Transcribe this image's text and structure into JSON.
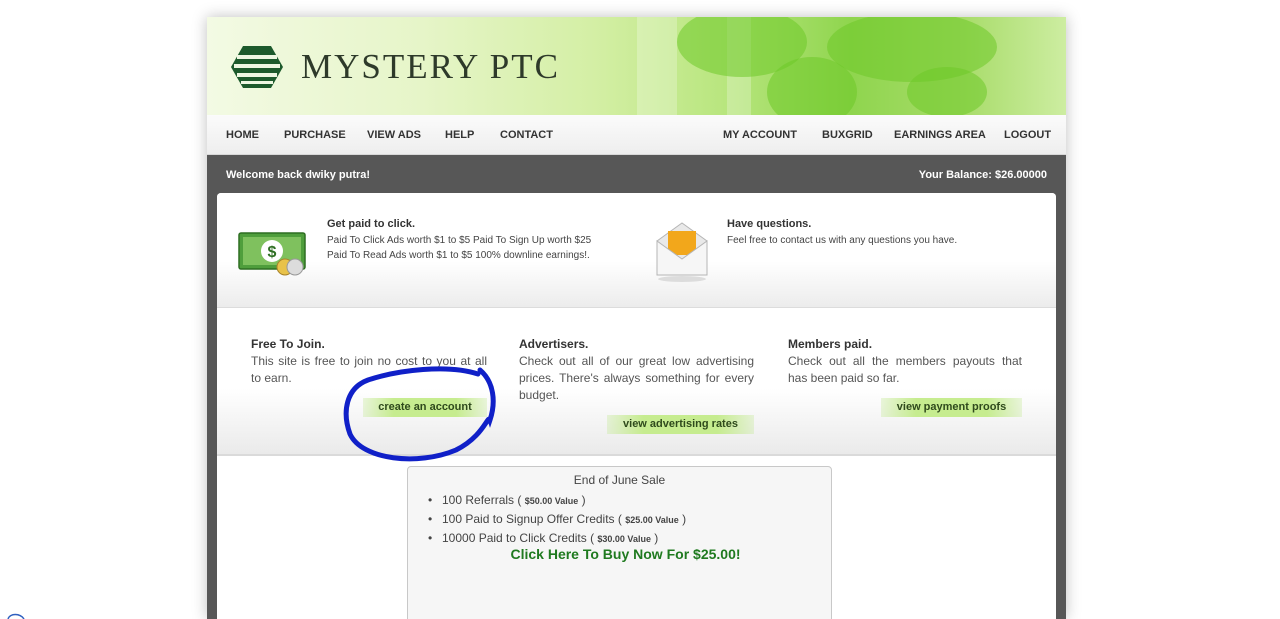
{
  "header": {
    "logo_text": "MYSTERY PTC",
    "logo_icon": "layered-hexagon-icon"
  },
  "nav": {
    "left": [
      "HOME",
      "PURCHASE",
      "VIEW ADS",
      "HELP",
      "CONTACT"
    ],
    "right": [
      "MY ACCOUNT",
      "BUXGRID",
      "EARNINGS AREA",
      "LOGOUT"
    ]
  },
  "bar": {
    "welcome": "Welcome back dwiky putra!",
    "balance": "Your Balance: $26.00000"
  },
  "info": {
    "paid": {
      "title": "Get paid to click.",
      "line1": "Paid To Click Ads worth $1 to $5 Paid To Sign Up worth $25",
      "line2": "Paid To Read Ads worth $1 to $5 100% downline earnings!.",
      "icon": "money-icon"
    },
    "questions": {
      "title": "Have questions.",
      "text": "Feel free to contact us with any questions you have.",
      "icon": "envelope-icon"
    }
  },
  "features": {
    "join": {
      "title": "Free To Join.",
      "text": "This site is free to join no cost to you at all to earn.",
      "button": "create an account"
    },
    "advertisers": {
      "title": "Advertisers.",
      "text": "Check out all of our great low advertising prices. There's always something for every budget.",
      "button": "view advertising rates"
    },
    "members": {
      "title": "Members paid.",
      "text": "Check out all the members payouts that has been paid so far.",
      "button": "view payment proofs"
    }
  },
  "sale": {
    "title": "End of June Sale",
    "items": [
      {
        "text": "100 Referrals ( ",
        "value": "$50.00 Value",
        "close": " )"
      },
      {
        "text": "100 Paid to Signup Offer Credits ( ",
        "value": "$25.00 Value",
        "close": " )"
      },
      {
        "text": "10000 Paid to Click Credits ( ",
        "value": "$30.00 Value",
        "close": " )"
      }
    ],
    "cta": "Click Here To Buy Now For $25.00!"
  },
  "colors": {
    "accent_green": "#1f7a1f",
    "button_green": "#c6ec8f",
    "dark_bar": "#575757",
    "annotation_blue": "#1020c8"
  }
}
